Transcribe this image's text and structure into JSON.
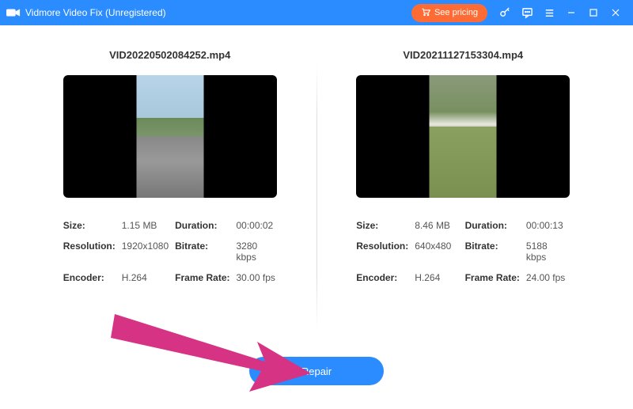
{
  "titlebar": {
    "app_name": "Vidmore Video Fix (Unregistered)",
    "pricing_label": "See pricing"
  },
  "left": {
    "filename": "VID20220502084252.mp4",
    "size_label": "Size:",
    "size": "1.15 MB",
    "duration_label": "Duration:",
    "duration": "00:00:02",
    "resolution_label": "Resolution:",
    "resolution": "1920x1080",
    "bitrate_label": "Bitrate:",
    "bitrate": "3280 kbps",
    "encoder_label": "Encoder:",
    "encoder": "H.264",
    "framerate_label": "Frame Rate:",
    "framerate": "30.00 fps"
  },
  "right": {
    "filename": "VID20211127153304.mp4",
    "size_label": "Size:",
    "size": "8.46 MB",
    "duration_label": "Duration:",
    "duration": "00:00:13",
    "resolution_label": "Resolution:",
    "resolution": "640x480",
    "bitrate_label": "Bitrate:",
    "bitrate": "5188 kbps",
    "encoder_label": "Encoder:",
    "encoder": "H.264",
    "framerate_label": "Frame Rate:",
    "framerate": "24.00 fps"
  },
  "footer": {
    "repair_label": "Repair"
  }
}
